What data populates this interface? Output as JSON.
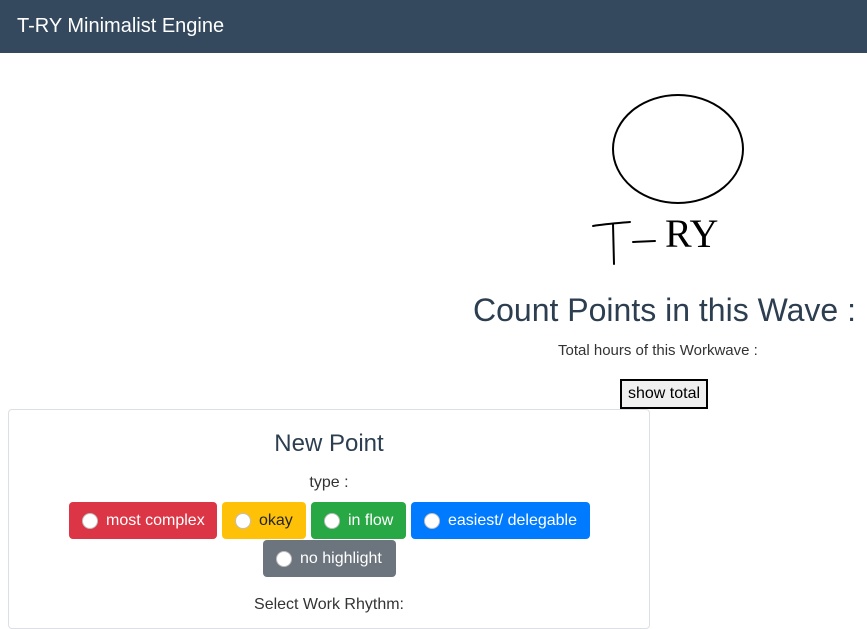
{
  "navbar": {
    "brand": "T-RY Minimalist Engine"
  },
  "wave": {
    "title": "Count Points in this Wave :",
    "total_hours_label": "Total hours of this Workwave :",
    "show_total_button": "show total"
  },
  "new_point": {
    "title": "New Point",
    "type_label": "type :",
    "types": [
      {
        "label": "most complex",
        "color": "#dc3545"
      },
      {
        "label": "okay",
        "color": "#ffc107"
      },
      {
        "label": "in flow",
        "color": "#28a745"
      },
      {
        "label": "easiest/ delegable",
        "color": "#007bff"
      },
      {
        "label": "no highlight",
        "color": "#6c757d"
      }
    ],
    "rhythm_label": "Select Work Rhythm:"
  },
  "colors": {
    "navbar_bg": "#34495e",
    "heading": "#2c3e50"
  }
}
